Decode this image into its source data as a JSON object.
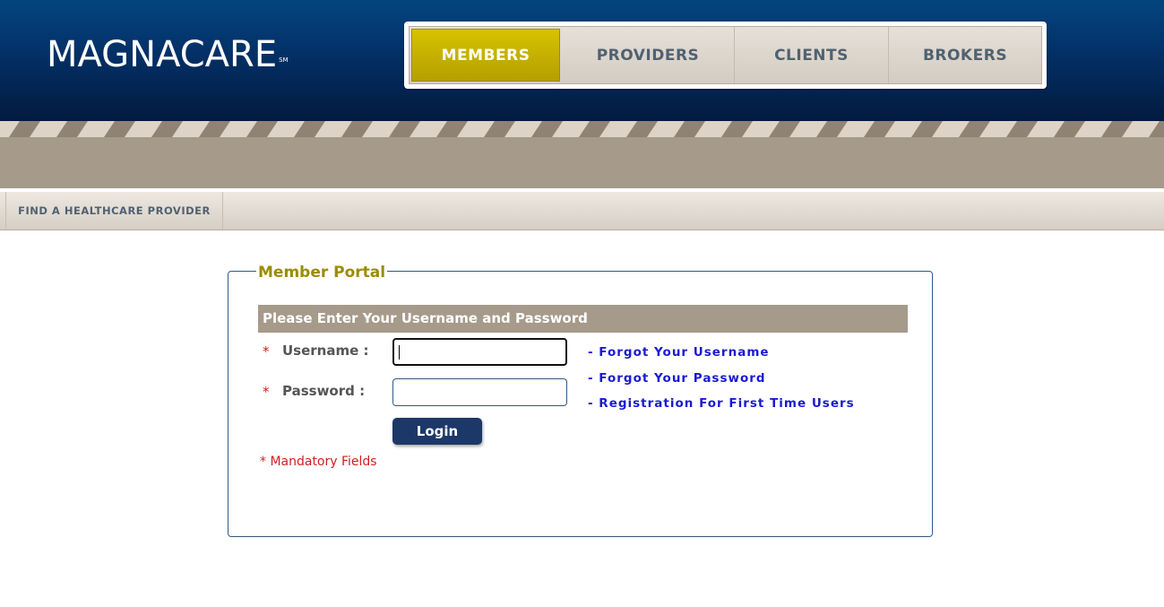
{
  "brand": {
    "logo_text": "MAGNACARE",
    "logo_mark": "SM"
  },
  "nav": {
    "tabs": [
      {
        "label": "MEMBERS",
        "active": true
      },
      {
        "label": "PROVIDERS",
        "active": false
      },
      {
        "label": "CLIENTS",
        "active": false
      },
      {
        "label": "BROKERS",
        "active": false
      }
    ]
  },
  "subnav": {
    "items": [
      {
        "label": "FIND A HEALTHCARE PROVIDER"
      }
    ]
  },
  "portal": {
    "title": "Member Portal",
    "form_header": "Please Enter Your Username and Password",
    "required_marker": "*",
    "username_label": "Username :",
    "username_value": "",
    "password_label": "Password :",
    "password_value": "",
    "login_label": "Login",
    "mandatory_note": "* Mandatory Fields",
    "links": [
      "- Forgot Your Username",
      "- Forgot Your Password",
      "- Registration For First Time Users"
    ]
  },
  "colors": {
    "header_blue": "#033066",
    "active_tab": "#c9b400",
    "band_taupe": "#a69a8a",
    "link_blue": "#1a1ad2",
    "required_red": "#d02020",
    "legend_olive": "#9a8c00",
    "button_navy": "#1c3868"
  }
}
